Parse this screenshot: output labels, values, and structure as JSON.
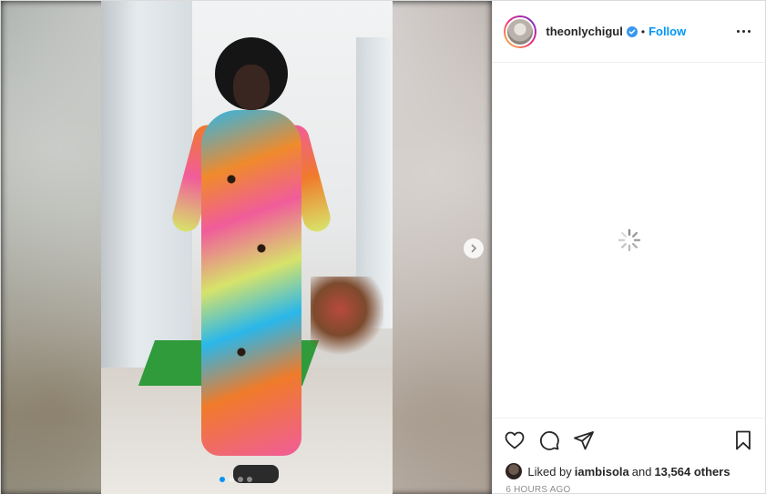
{
  "header": {
    "username": "theonlychigul",
    "separator": "•",
    "follow_label": "Follow",
    "verified": true
  },
  "media": {
    "carousel_count": 4,
    "active_index": 0
  },
  "comments": {
    "loading": true
  },
  "actions": {
    "icons": [
      "heart-icon",
      "comment-icon",
      "share-icon",
      "bookmark-icon"
    ]
  },
  "likes": {
    "prefix": "Liked by",
    "liker": "iambisola",
    "joiner": "and",
    "others": "13,564 others"
  },
  "timestamp": "6 HOURS AGO",
  "colors": {
    "accent": "#0095f6",
    "text": "#262626",
    "muted": "#8e8e8e",
    "border": "#dbdbdb"
  }
}
